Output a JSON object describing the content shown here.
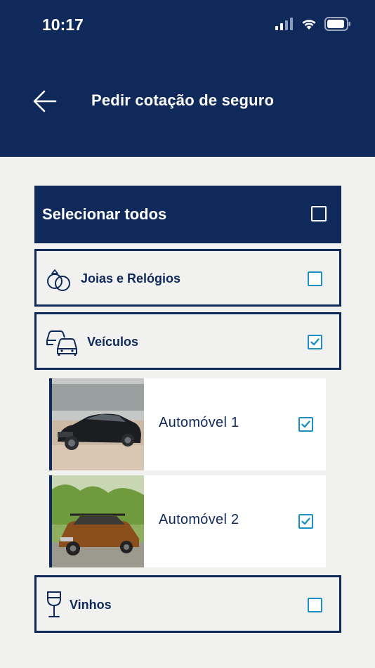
{
  "status_bar": {
    "time": "10:17"
  },
  "header": {
    "title": "Pedir cotação de seguro",
    "back_icon": "arrow-left-icon"
  },
  "select_all": {
    "label": "Selecionar todos",
    "checked": false
  },
  "categories": [
    {
      "label": "Joias e Relógios",
      "icon": "rings-icon",
      "checked": false
    },
    {
      "label": "Veículos",
      "icon": "cars-icon",
      "checked": true
    },
    {
      "label": "Vinhos",
      "icon": "wine-glass-icon",
      "checked": false
    }
  ],
  "vehicles": [
    {
      "label": "Automóvel 1",
      "checked": true
    },
    {
      "label": "Automóvel 2",
      "checked": true
    }
  ],
  "colors": {
    "primary": "#0f2a5a",
    "checkbox": "#1c8fc4",
    "background": "#f1f1f0"
  }
}
